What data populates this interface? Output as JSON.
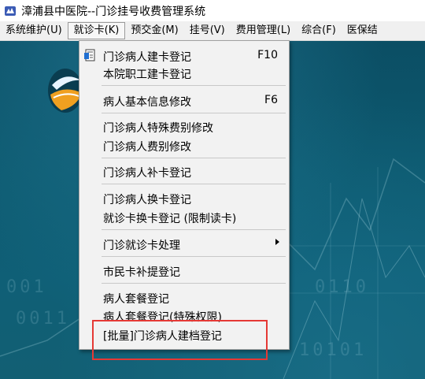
{
  "window": {
    "title": "漳浦县中医院--门诊挂号收费管理系统",
    "icon": "app-logo-icon"
  },
  "menubar": {
    "items": [
      {
        "label": "系统维护(U)"
      },
      {
        "label": "就诊卡(K)",
        "active": true
      },
      {
        "label": "预交金(M)"
      },
      {
        "label": "挂号(V)"
      },
      {
        "label": "费用管理(L)"
      },
      {
        "label": "综合(F)"
      },
      {
        "label": "医保结"
      }
    ]
  },
  "dropdown": {
    "items": [
      {
        "label": "门诊病人建卡登记",
        "shortcut": "F10",
        "icon": "card-register-icon"
      },
      {
        "label": "本院职工建卡登记"
      },
      {
        "label": "病人基本信息修改",
        "shortcut": "F6"
      },
      {
        "label": "门诊病人特殊费别修改"
      },
      {
        "label": "门诊病人费别修改"
      },
      {
        "label": "门诊病人补卡登记"
      },
      {
        "label": "门诊病人换卡登记"
      },
      {
        "label": "就诊卡换卡登记 (限制读卡)"
      },
      {
        "label": "门诊就诊卡处理",
        "submenu": true
      },
      {
        "label": "市民卡补提登记"
      },
      {
        "label": "病人套餐登记"
      },
      {
        "label": "病人套餐登记(特殊权限)"
      },
      {
        "label": "[批量]门诊病人建档登记",
        "highlighted": true
      }
    ]
  },
  "background": {
    "digits": [
      "001",
      "0011",
      "0110",
      "10101"
    ]
  },
  "colors": {
    "highlight_border": "#e53935",
    "desktop": "#0d5a70",
    "menu_bg": "#f2f2f2"
  }
}
